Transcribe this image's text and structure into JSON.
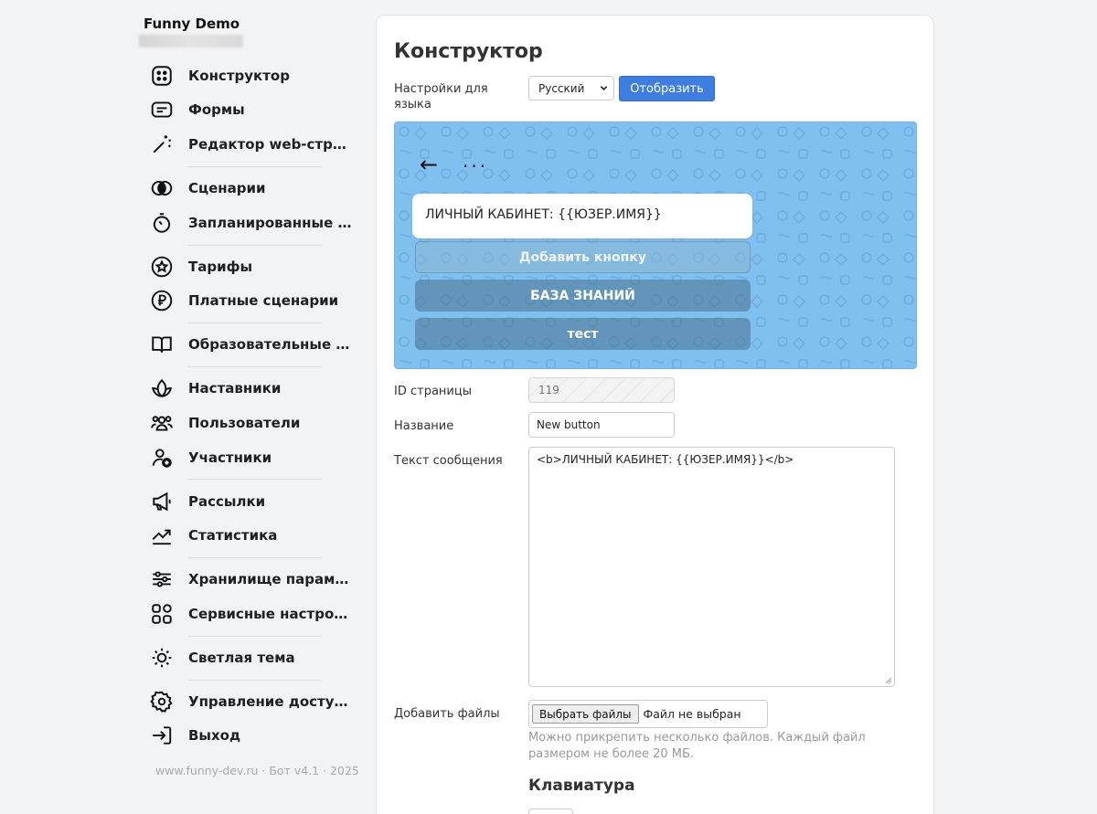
{
  "sidebar": {
    "brand": "Funny Demo",
    "items": [
      {
        "icon": "grid-dots-icon",
        "label": "Конструктор"
      },
      {
        "icon": "form-icon",
        "label": "Формы"
      },
      {
        "icon": "magic-wand-icon",
        "label": "Редактор web-страниц"
      },
      {
        "icon": "overlap-circles-icon",
        "label": "Сценарии"
      },
      {
        "icon": "stopwatch-icon",
        "label": "Запланированные с..."
      },
      {
        "icon": "star-badge-icon",
        "label": "Тарифы"
      },
      {
        "icon": "ruble-coin-icon",
        "label": "Платные сценарии"
      },
      {
        "icon": "book-icon",
        "label": "Образовательные м..."
      },
      {
        "icon": "lotus-icon",
        "label": "Наставники"
      },
      {
        "icon": "users-icon",
        "label": "Пользователи"
      },
      {
        "icon": "user-add-icon",
        "label": "Участники"
      },
      {
        "icon": "megaphone-icon",
        "label": "Рассылки"
      },
      {
        "icon": "trend-chart-icon",
        "label": "Статистика"
      },
      {
        "icon": "sliders-icon",
        "label": "Хранилище парамет..."
      },
      {
        "icon": "apps-grid-icon",
        "label": "Сервисные настройки"
      },
      {
        "icon": "sun-icon",
        "label": "Светлая тема"
      },
      {
        "icon": "gear-icon",
        "label": "Управление доступом"
      },
      {
        "icon": "logout-icon",
        "label": "Выход"
      }
    ],
    "footer": "www.funny-dev.ru · Бот v4.1 · 2025"
  },
  "main": {
    "title": "Конструктор",
    "lang_label": "Настройки для языка",
    "lang_value": "Русский",
    "show_button": "Отобразить",
    "preview": {
      "back": "←",
      "menu": "···",
      "message": "ЛИЧНЫЙ КАБИНЕТ: {{ЮЗЕР.ИМЯ}}",
      "add_button": "Добавить кнопку",
      "buttons": [
        "БАЗА ЗНАНИЙ",
        "тест"
      ]
    },
    "form": {
      "id_label": "ID страницы",
      "id_value": "119",
      "name_label": "Название",
      "name_value": "New button",
      "text_label": "Текст сообщения",
      "text_value": "<b>ЛИЧНЫЙ КАБИНЕТ: {{ЮЗЕР.ИМЯ}}</b>",
      "files_label": "Добавить файлы",
      "choose_files": "Выбрать файлы",
      "no_file": "Файл не выбран",
      "files_hint": "Можно прикрепить несколько файлов. Каждый файл размером не более 20 МБ.",
      "keyboard_title": "Клавиатура"
    }
  },
  "colors": {
    "accent": "#3f7ee0",
    "preview_bg": "#80c0f0"
  }
}
